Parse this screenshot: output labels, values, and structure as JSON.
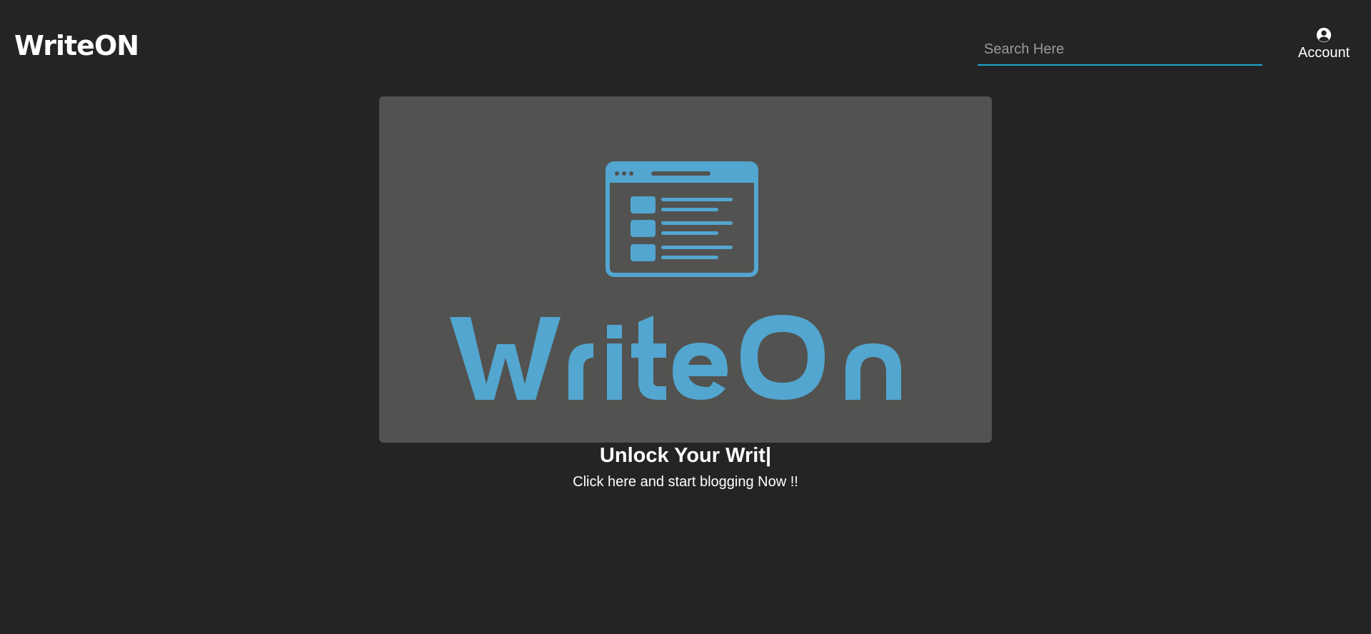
{
  "header": {
    "brand": "WriteON",
    "search": {
      "placeholder": "Search Here",
      "value": ""
    },
    "account": {
      "label": "Account",
      "icon": "account-circle-icon"
    }
  },
  "hero": {
    "logo_text": "WriteOn",
    "logo_icon": "browser-window-icon",
    "headline": "Unlock Your Writ|",
    "cta": "Click here and start blogging Now !!"
  },
  "colors": {
    "background": "#242424",
    "card": "#525250",
    "accent": "#1aa6c9",
    "logo": "#52a6cf",
    "text": "#ffffff"
  }
}
